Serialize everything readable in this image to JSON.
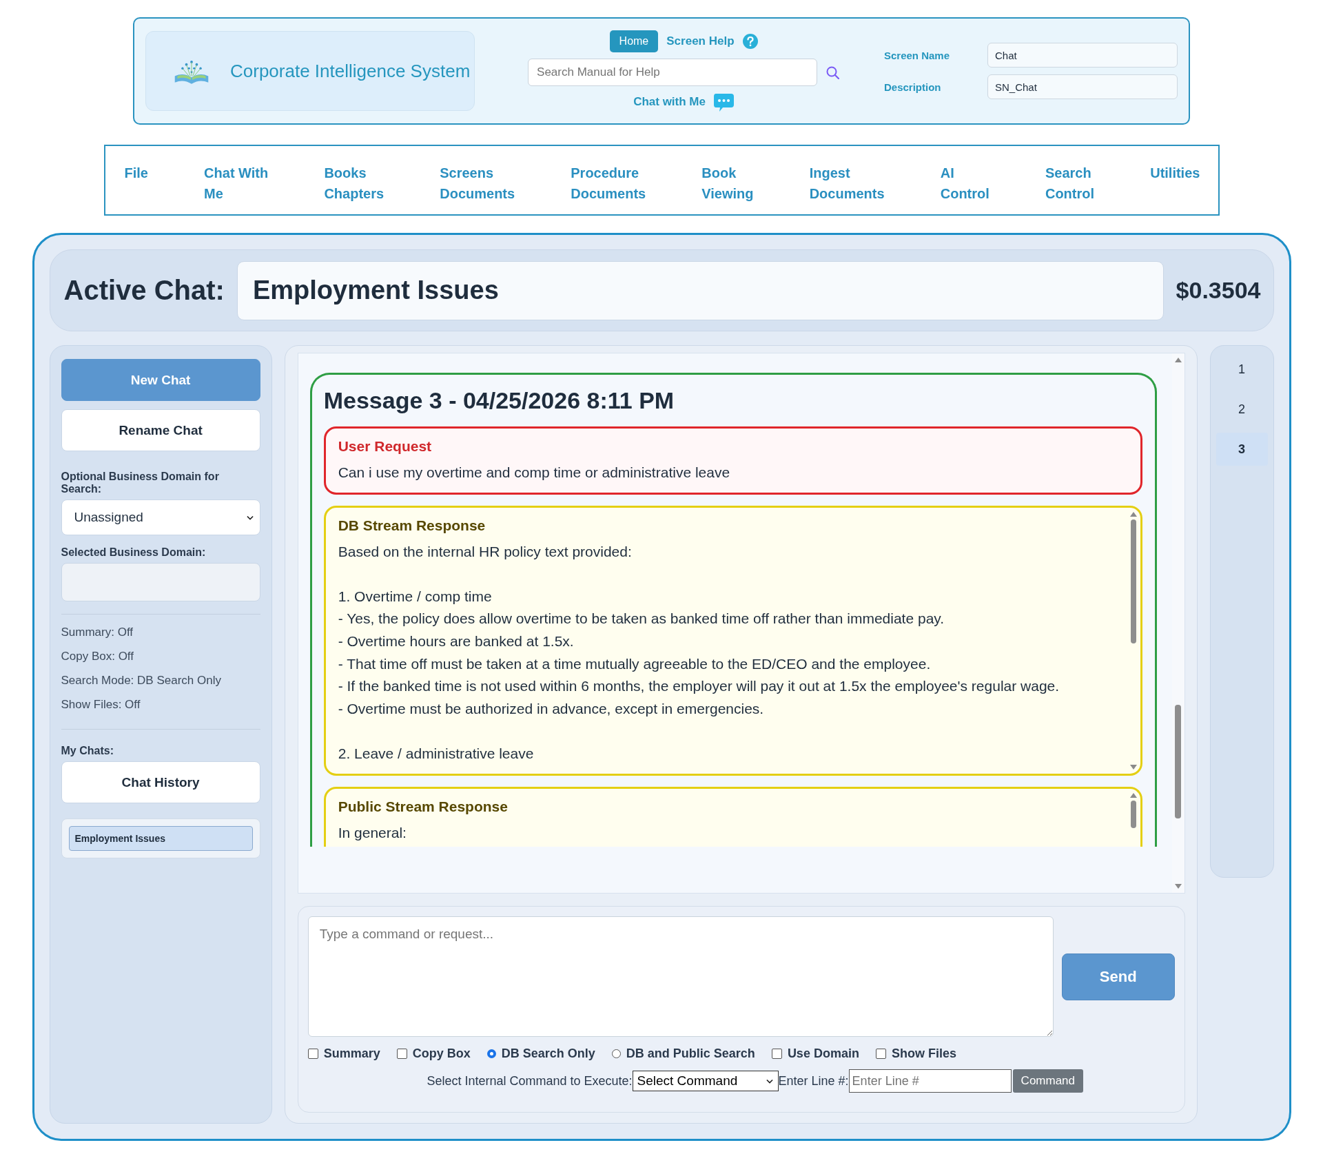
{
  "header": {
    "logo_title": "Corporate Intelligence System",
    "home_button": "Home",
    "help_link": "Screen Help",
    "search": {
      "placeholder": "Search Manual for Help"
    },
    "chat_link": "Chat with Me",
    "fields": [
      {
        "label": "Screen Name",
        "value": "Chat"
      },
      {
        "label": "Description",
        "value": "SN_Chat"
      }
    ]
  },
  "nav": [
    {
      "lines": [
        "File"
      ]
    },
    {
      "lines": [
        "Chat With",
        "Me"
      ]
    },
    {
      "lines": [
        "Books",
        "Chapters"
      ]
    },
    {
      "lines": [
        "Screens",
        "Documents"
      ]
    },
    {
      "lines": [
        "Procedure",
        "Documents"
      ]
    },
    {
      "lines": [
        "Book",
        "Viewing"
      ]
    },
    {
      "lines": [
        "Ingest",
        "Documents"
      ]
    },
    {
      "lines": [
        "AI",
        "Control"
      ]
    },
    {
      "lines": [
        "Search",
        "Control"
      ]
    },
    {
      "lines": [
        "Utilities"
      ]
    }
  ],
  "active_chat": {
    "label": "Active Chat:",
    "title": "Employment Issues",
    "cost": "$0.3504"
  },
  "sidebar": {
    "buttons": [
      {
        "label": "New Chat",
        "kind": "primary"
      },
      {
        "label": "Rename Chat",
        "kind": "secondary"
      }
    ],
    "domain_label": "Optional Business Domain for Search:",
    "domain_select": "Unassigned",
    "selected_domain_label": "Selected Business Domain:",
    "status": [
      "Summary: Off",
      "Copy Box: Off",
      "Search Mode: DB Search Only",
      "Show Files: Off"
    ],
    "my_chats_label": "My Chats:",
    "history_button": "Chat History",
    "chats": [
      {
        "title": "Employment Issues",
        "selected": true
      }
    ]
  },
  "message": {
    "title": "Message 3 - 04/25/2026 8:11 PM",
    "sections": [
      {
        "kind": "request",
        "title": "User Request",
        "body": "Can i use my overtime and comp time or administrative leave"
      },
      {
        "kind": "response",
        "title": "DB Stream Response",
        "body": "Based on the internal HR policy text provided:\n\n1. Overtime / comp time\n- Yes, the policy does allow overtime to be taken as banked time off rather than immediate pay.\n- Overtime hours are banked at 1.5x.\n- That time off must be taken at a time mutually agreeable to the ED/CEO and the employee.\n- If the banked time is not used within 6 months, the employer will pay it out at 1.5x the employee's regular wage.\n- Overtime must be authorized in advance, except in emergencies.\n\n2. Leave / administrative leave"
      },
      {
        "kind": "response",
        "title": "Public Stream Response",
        "body": "In general:"
      }
    ]
  },
  "pages": [
    {
      "label": "1",
      "selected": false
    },
    {
      "label": "2",
      "selected": false
    },
    {
      "label": "3",
      "selected": true
    }
  ],
  "composer": {
    "placeholder": "Type a command or request...",
    "send_button": "Send",
    "options": [
      {
        "kind": "checkbox",
        "label": "Summary",
        "checked": false
      },
      {
        "kind": "checkbox",
        "label": "Copy Box",
        "checked": false
      },
      {
        "kind": "radio",
        "label": "DB Search Only",
        "selected": true
      },
      {
        "kind": "radio",
        "label": "DB and Public Search",
        "selected": false
      },
      {
        "kind": "checkbox",
        "label": "Use Domain",
        "checked": false
      },
      {
        "kind": "checkbox",
        "label": "Show Files",
        "checked": false
      }
    ],
    "command_label": "Select Internal Command to Execute:",
    "command_select": "Select Command",
    "line_label": "Enter Line #:",
    "line_input": {
      "placeholder": "Enter Line #"
    },
    "command_button": "Command"
  }
}
